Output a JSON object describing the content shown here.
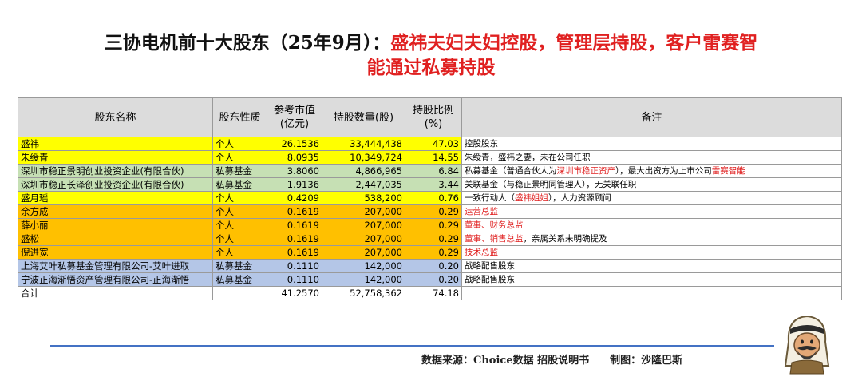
{
  "title": {
    "part1": "三协电机前十大股东（25年9月）：",
    "part2": "盛祎夫妇夫妇控股，管理层持股，客户雷赛智",
    "part3": "能通过私募持股"
  },
  "table": {
    "headers": [
      "股东名称",
      "股东性质",
      "参考市值(亿元)",
      "持股数量(股)",
      "持股比例(%)",
      "备注"
    ],
    "rows": [
      {
        "name": "盛祎",
        "type": "个人",
        "value": "26.1536",
        "shares": "33,444,438",
        "pct": "47.03",
        "note": [
          {
            "t": "控股股东",
            "red": false
          }
        ]
      },
      {
        "name": "朱绶青",
        "type": "个人",
        "value": "8.0935",
        "shares": "10,349,724",
        "pct": "14.55",
        "note": [
          {
            "t": "朱绶青，盛祎之妻，未在公司任职",
            "red": false
          }
        ]
      },
      {
        "name": "深圳市稳正景明创业投资企业(有限合伙)",
        "type": "私募基金",
        "value": "3.8060",
        "shares": "4,866,965",
        "pct": "6.84",
        "note": [
          {
            "t": "私募基金（普通合伙人为",
            "red": false
          },
          {
            "t": "深圳市稳正资产",
            "red": true
          },
          {
            "t": "），最大出资方为上市公司",
            "red": false
          },
          {
            "t": "雷赛智能",
            "red": true
          }
        ]
      },
      {
        "name": "深圳市稳正长泽创业投资企业(有限合伙)",
        "type": "私募基金",
        "value": "1.9136",
        "shares": "2,447,035",
        "pct": "3.44",
        "note": [
          {
            "t": "关联基金（与稳正景明同管理人），无关联任职",
            "red": false
          }
        ]
      },
      {
        "name": "盛月瑶",
        "type": "个人",
        "value": "0.4209",
        "shares": "538,200",
        "pct": "0.76",
        "note": [
          {
            "t": "一致行动人（",
            "red": false
          },
          {
            "t": "盛祎姐姐",
            "red": true
          },
          {
            "t": "），人力资源顾问",
            "red": false
          }
        ]
      },
      {
        "name": "余方成",
        "type": "个人",
        "value": "0.1619",
        "shares": "207,000",
        "pct": "0.29",
        "note": [
          {
            "t": "运营总监",
            "red": true
          }
        ]
      },
      {
        "name": "薛小丽",
        "type": "个人",
        "value": "0.1619",
        "shares": "207,000",
        "pct": "0.29",
        "note": [
          {
            "t": "董事、财务总监",
            "red": true
          }
        ]
      },
      {
        "name": "盛松",
        "type": "个人",
        "value": "0.1619",
        "shares": "207,000",
        "pct": "0.29",
        "note": [
          {
            "t": "董事、销售总监",
            "red": true
          },
          {
            "t": "，亲属关系未明确提及",
            "red": false
          }
        ]
      },
      {
        "name": "倪进宽",
        "type": "个人",
        "value": "0.1619",
        "shares": "207,000",
        "pct": "0.29",
        "note": [
          {
            "t": "技术总监",
            "red": true
          }
        ]
      },
      {
        "name": "上海艾叶私募基金管理有限公司-艾叶进取",
        "type": "私募基金",
        "value": "0.1110",
        "shares": "142,000",
        "pct": "0.20",
        "note": [
          {
            "t": "战略配售股东",
            "red": false
          }
        ]
      },
      {
        "name": "宁波正海渐悟资产管理有限公司-正海渐悟",
        "type": "私募基金",
        "value": "0.1110",
        "shares": "142,000",
        "pct": "0.20",
        "note": [
          {
            "t": "战略配售股东",
            "red": false
          }
        ]
      }
    ],
    "total": {
      "name": "合计",
      "type": "",
      "value": "41.2570",
      "shares": "52,758,362",
      "pct": "74.18",
      "note": ""
    }
  },
  "footer": {
    "source": "数据来源：Choice数据 招股说明书",
    "maker": "制图：沙隆巴斯"
  },
  "colors": {
    "highlight_red": "#e02020",
    "row_yellow": "#ffff00",
    "row_green": "#c6e0b4",
    "row_orange": "#ffc000",
    "row_blue": "#b4c6e7",
    "divider_blue": "#4472c4"
  },
  "logo": {
    "icon": "cartoon-mascot-icon"
  }
}
